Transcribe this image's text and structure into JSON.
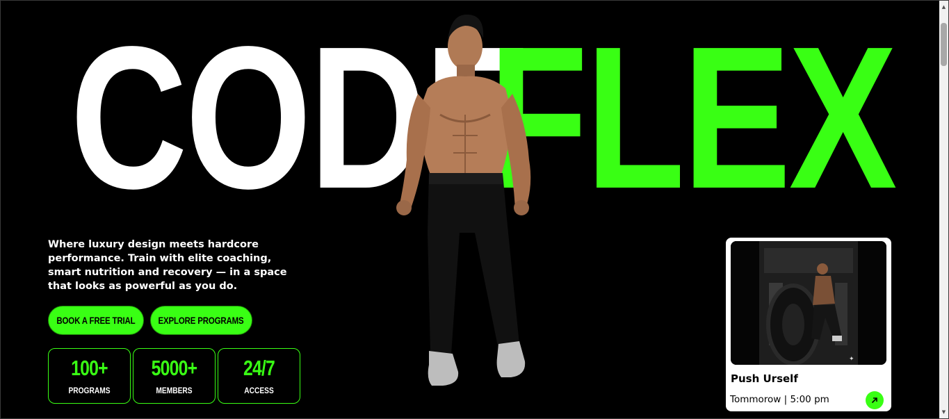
{
  "hero": {
    "title_part1": "CODE",
    "title_part2": "FLEX",
    "description": "Where luxury design meets hardcore performance. Train with elite coaching, smart nutrition and recovery — in a space that looks as powerful as you do.",
    "buttons": {
      "trial_label": "BOOK A FREE TRIAL",
      "explore_label": "EXPLORE PROGRAMS"
    },
    "stats": [
      {
        "value": "100+",
        "label": "PROGRAMS"
      },
      {
        "value": "5000+",
        "label": "MEMBERS"
      },
      {
        "value": "24/7",
        "label": "ACCESS"
      }
    ]
  },
  "event_card": {
    "title": "Push Urself",
    "time": "Tommorow | 5:00 pm",
    "image_icon": "sparkle-icon",
    "action_icon": "arrow-up-right-icon"
  },
  "colors": {
    "accent": "#39ff14",
    "background": "#000000",
    "text": "#ffffff"
  }
}
